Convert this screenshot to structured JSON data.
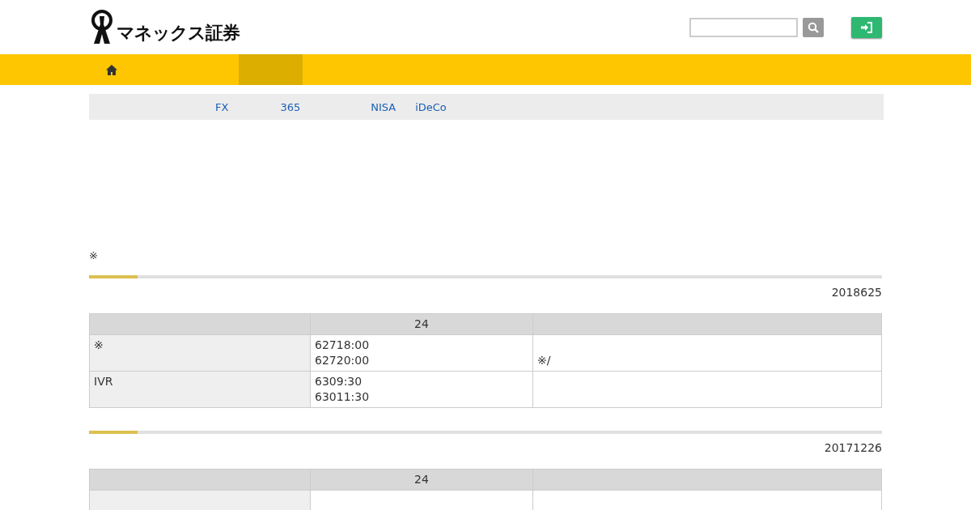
{
  "header": {
    "logo": "マネックス証券"
  },
  "nav": {
    "tabs": [
      {
        "kind": "home",
        "selected": false
      },
      {
        "kind": "blank",
        "selected": true
      }
    ]
  },
  "subnav": {
    "links": [
      "FX",
      "365",
      "NISA",
      "iDeCo"
    ]
  },
  "note": "※",
  "sections": [
    {
      "date": "2018625",
      "columns": [
        "",
        "24",
        ""
      ],
      "rows": [
        [
          "※",
          "62718:00\n62720:00",
          "※/"
        ],
        [
          "IVR",
          "6309:30\n63011:30",
          ""
        ]
      ]
    },
    {
      "date": "20171226",
      "columns": [
        "",
        "24",
        ""
      ],
      "rows": [
        [
          "",
          "",
          ""
        ]
      ]
    }
  ]
}
